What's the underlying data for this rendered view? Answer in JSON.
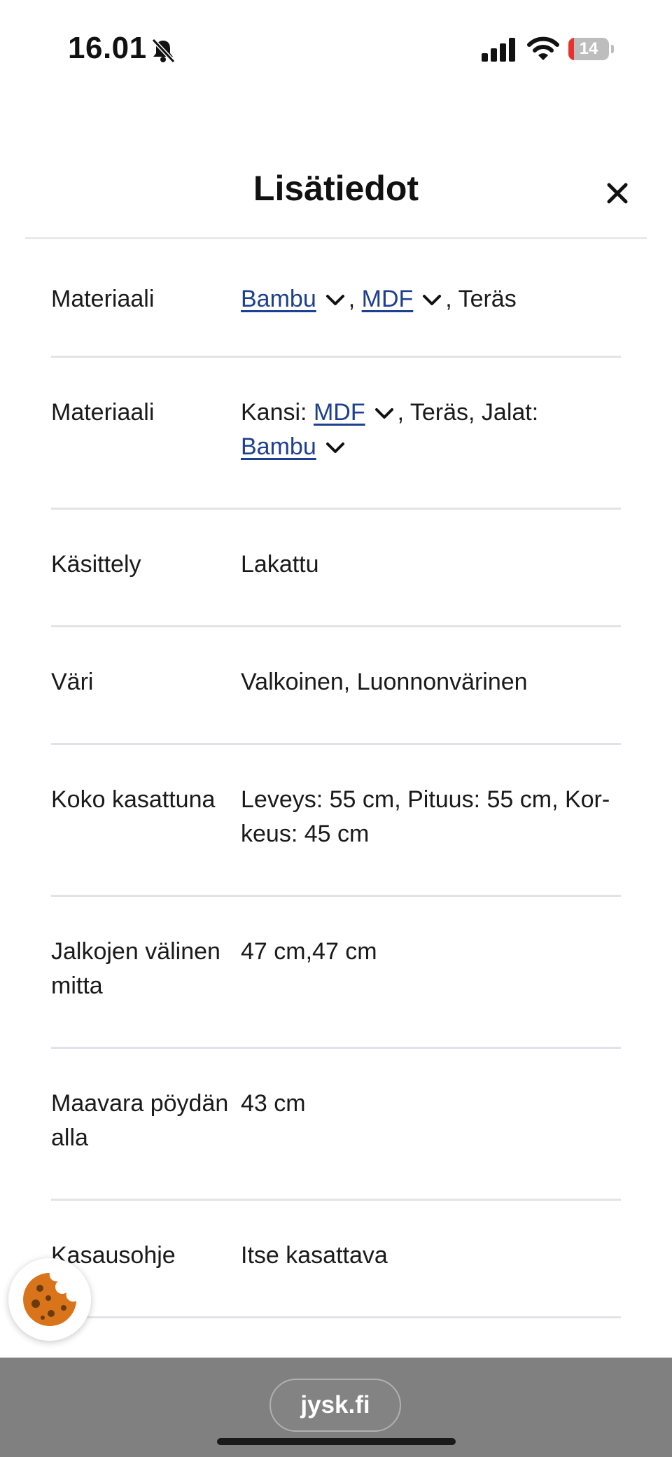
{
  "status_bar": {
    "time": "16.01",
    "battery": "14",
    "battery_level": 0.14
  },
  "modal": {
    "title": "Lisätiedot",
    "close_symbol": "×"
  },
  "rows": {
    "r0": {
      "label": "Materiaali",
      "link1": "Bambu",
      "sep1": ", ",
      "link2": "MDF",
      "tail": ", Teräs"
    },
    "r1": {
      "label": "Materiaali",
      "prefix": "Kansi: ",
      "link1": "MDF",
      "middle": ", Teräs, Jalat:",
      "link2": "Bambu"
    },
    "r2": {
      "label": "Käsittely",
      "value": "Lakattu"
    },
    "r3": {
      "label": "Väri",
      "value": "Valkoinen, Luonnonvärinen"
    },
    "r4": {
      "label": "Koko kasattuna",
      "line1": "Leveys: 55 cm, Pituus: 55 cm, Kor-",
      "line2": "keus: 45 cm"
    },
    "r5": {
      "label_line1": "Jalkojen välinen",
      "label_line2": "mitta",
      "value": "47 cm,47 cm"
    },
    "r6": {
      "label_line1": "Maavara pöydän",
      "label_line2": "alla",
      "value": "43 cm"
    },
    "r7": {
      "label": "Kasausohje",
      "value": "Itse kasattava"
    }
  },
  "browser": {
    "url": "jysk.fi"
  },
  "icons": {
    "bell": "bell-slash-icon",
    "signal": "cellular-signal-icon",
    "wifi": "wifi-icon",
    "battery": "battery-icon",
    "close": "close-icon",
    "chevron": "chevron-down-icon",
    "cookie": "cookie-icon"
  },
  "colors": {
    "link": "#1d3f8f",
    "divider": "#e2e3e8",
    "bottom_bar": "#808080",
    "cookie": "#d9741a"
  }
}
